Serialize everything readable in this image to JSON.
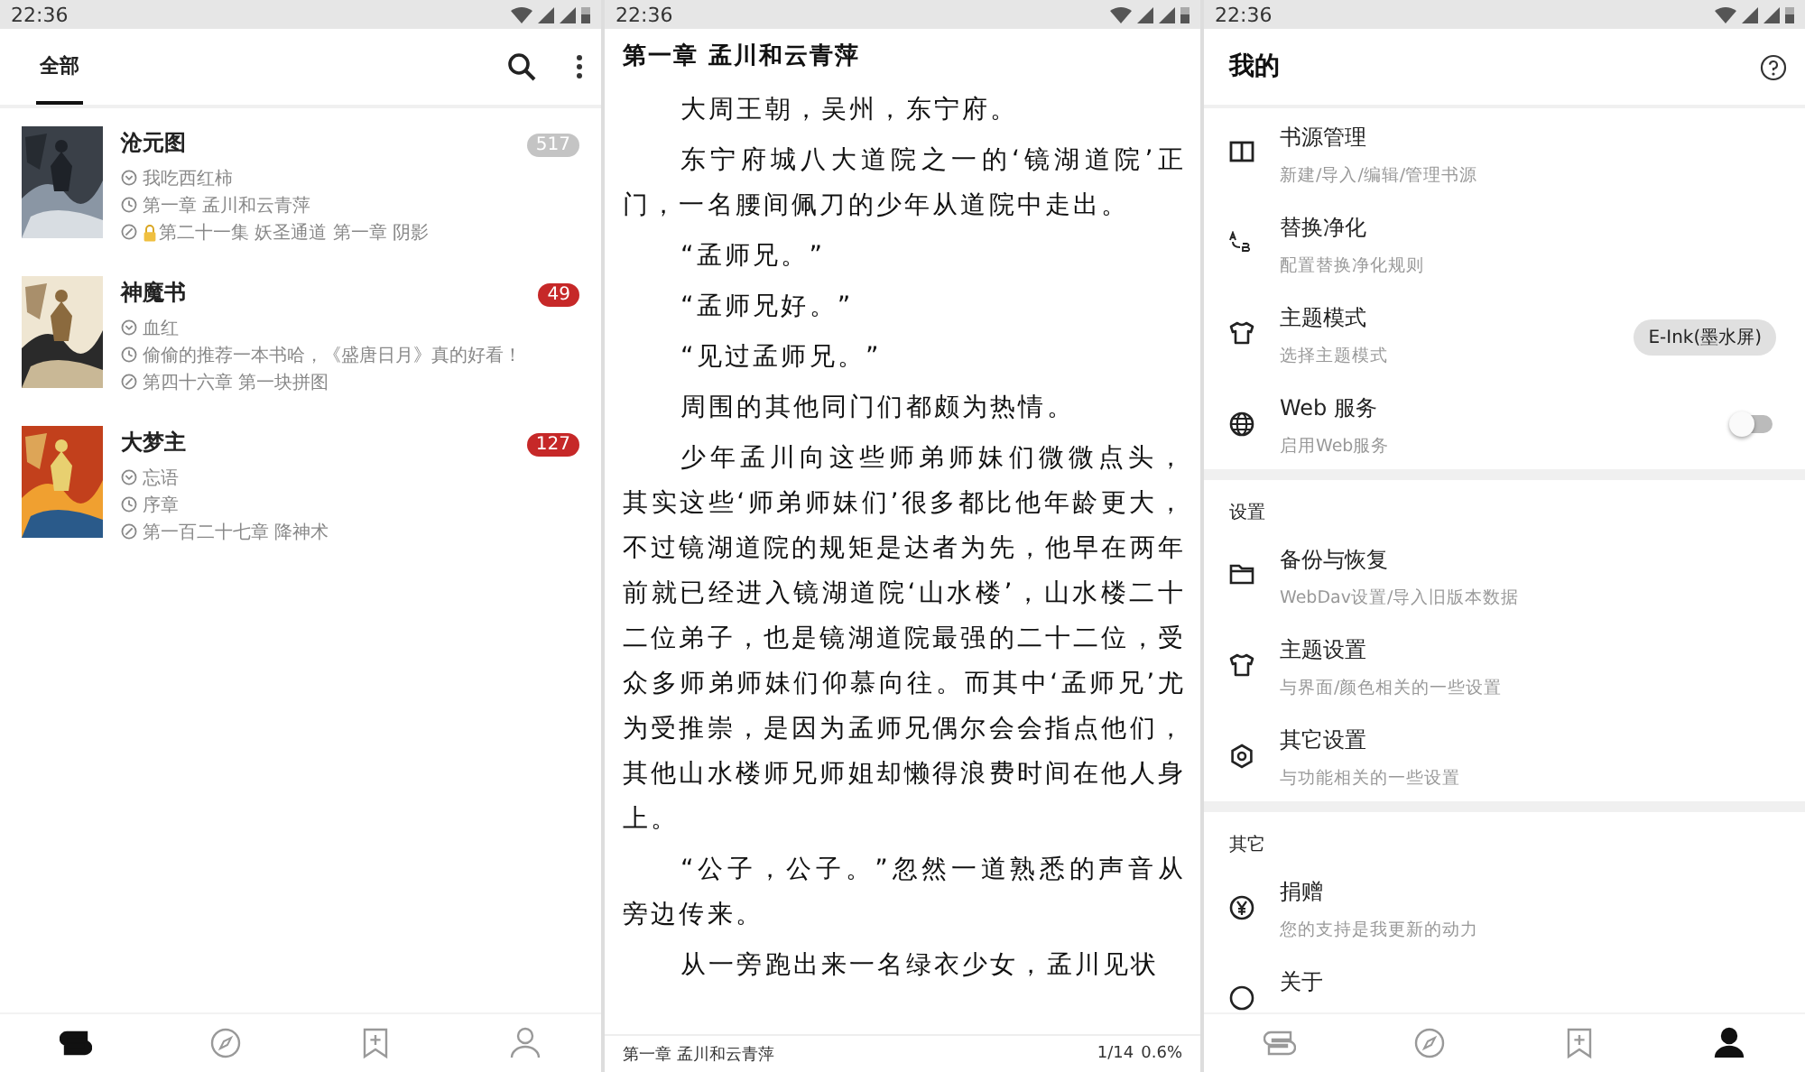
{
  "bookshelf": {
    "status_time": "22:36",
    "tabs": [
      {
        "label": "全部",
        "selected": true
      }
    ],
    "books": [
      {
        "title": "沧元图",
        "author": "我吃西红柿",
        "last_read": "第一章 孟川和云青萍",
        "latest": "第二十一集 妖圣通道 第一章 阴影",
        "locked": true,
        "count": "517",
        "color": "#c4c4c4"
      },
      {
        "title": "神魔书",
        "author": "血红",
        "last_read": "偷偷的推荐一本书哈，《盛唐日月》真的好看！",
        "latest": "第四十六章 第一块拼图",
        "locked": false,
        "count": "49",
        "color": "#c62828"
      },
      {
        "title": "大梦主",
        "author": "忘语",
        "last_read": "序章",
        "latest": "第一百二十七章 降神术",
        "locked": false,
        "count": "127",
        "color": "#c62828"
      }
    ],
    "nav": [
      {
        "selected": true
      },
      {
        "selected": false
      },
      {
        "selected": false
      },
      {
        "selected": false
      }
    ]
  },
  "reader": {
    "status_time": "22:36",
    "chapter_title": "第一章 孟川和云青萍",
    "paragraphs": [
      "大周王朝，吴州，东宁府。",
      "东宁府城八大道院之一的‘镜湖道院’正门，一名腰间佩刀的少年从道院中走出。",
      "“孟师兄。”",
      "“孟师兄好。”",
      "“见过孟师兄。”",
      "周围的其他同门们都颇为热情。",
      "少年孟川向这些师弟师妹们微微点头，其实这些‘师弟师妹们’很多都比他年龄更大，不过镜湖道院的规矩是达者为先，他早在两年前就已经进入镜湖道院‘山水楼’，山水楼二十二位弟子，也是镜湖道院最强的二十二位，受众多师弟师妹们仰慕向往。而其中‘孟师兄’尤为受推崇，是因为孟师兄偶尔会会指点他们，其他山水楼师兄师姐却懒得浪费时间在他人身上。",
      "“公子，公子。”忽然一道熟悉的声音从旁边传来。",
      "从一旁跑出来一名绿衣少女，孟川见状"
    ],
    "footer_title": "第一章 孟川和云青萍",
    "page": "1/14",
    "percent": "0.6%"
  },
  "profile": {
    "status_time": "22:36",
    "title": "我的",
    "sections": [
      {
        "items": [
          {
            "kind": "plain",
            "title": "书源管理",
            "subtitle": "新建/导入/编辑/管理书源"
          },
          {
            "kind": "plain",
            "title": "替换净化",
            "subtitle": "配置替换净化规则"
          },
          {
            "kind": "chip",
            "title": "主题模式",
            "subtitle": "选择主题模式",
            "value": "E-Ink(墨水屏)"
          },
          {
            "kind": "switch",
            "title": "Web 服务",
            "subtitle": "启用Web服务",
            "on": false
          }
        ]
      },
      {
        "label": "设置",
        "items": [
          {
            "kind": "plain",
            "title": "备份与恢复",
            "subtitle": "WebDav设置/导入旧版本数据"
          },
          {
            "kind": "plain",
            "title": "主题设置",
            "subtitle": "与界面/颜色相关的一些设置"
          },
          {
            "kind": "plain",
            "title": "其它设置",
            "subtitle": "与功能相关的一些设置"
          }
        ]
      },
      {
        "label": "其它",
        "items": [
          {
            "kind": "plain",
            "title": "捐赠",
            "subtitle": "您的支持是我更新的动力"
          },
          {
            "kind": "plain",
            "title": "关于"
          }
        ]
      }
    ],
    "nav": [
      {
        "selected": false
      },
      {
        "selected": false
      },
      {
        "selected": false
      },
      {
        "selected": true
      }
    ]
  }
}
